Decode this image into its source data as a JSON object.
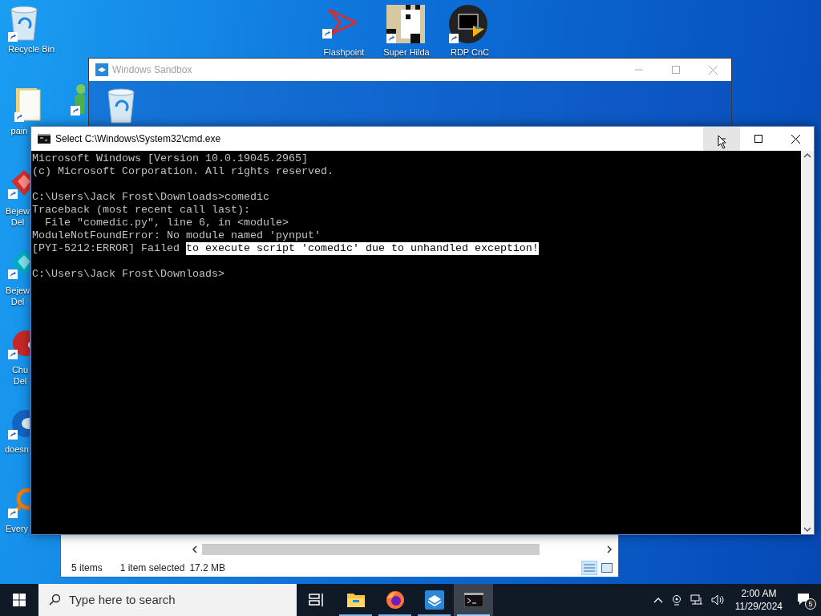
{
  "desktop_icons": [
    {
      "kind": "recycle-bin",
      "label": "Recycle Bin"
    },
    {
      "kind": "folder",
      "label": "pain"
    },
    {
      "kind": "person"
    },
    {
      "kind": "red-gem",
      "label": "Bejew Del"
    },
    {
      "kind": "blue-gem",
      "label": "Bejew Del"
    },
    {
      "kind": "red-ball",
      "label": "Chu Del"
    },
    {
      "kind": "blue-ball",
      "label": "doesn"
    },
    {
      "kind": "orange-ring",
      "label": "Every"
    },
    {
      "kind": "flashpoint",
      "label": "Flashpoint"
    },
    {
      "kind": "pixel-art",
      "label": "Super Hilda"
    },
    {
      "kind": "remote",
      "label": "RDP CnC"
    }
  ],
  "sandbox_window": {
    "title": "Windows Sandbox",
    "desktop_icons": [
      {
        "kind": "recycle-bin"
      }
    ]
  },
  "explorer_window": {
    "status": [
      {
        "text": "5 items"
      },
      {
        "text": "1 item selected"
      },
      {
        "text": "17.2 MB"
      }
    ],
    "views": [
      {
        "kind": "details",
        "selected": true
      },
      {
        "kind": "tiles",
        "selected": false
      }
    ]
  },
  "cmd_window": {
    "title": "Select C:\\Windows\\System32\\cmd.exe",
    "controls": [
      {
        "kind": "minimize",
        "hovered": true
      },
      {
        "kind": "maximize",
        "hovered": false
      },
      {
        "kind": "close",
        "hovered": false
      }
    ],
    "lines": [
      {
        "segments": [
          {
            "text": "Microsoft Windows [Version 10.0.19045.2965]",
            "selected": false
          }
        ]
      },
      {
        "segments": [
          {
            "text": "(c) Microsoft Corporation. All rights reserved.",
            "selected": false
          }
        ]
      },
      {
        "kind": "blank"
      },
      {
        "segments": [
          {
            "text": "C:\\Users\\Jack Frost\\Downloads>comedic",
            "selected": false
          }
        ]
      },
      {
        "segments": [
          {
            "text": "Traceback (most recent call last):",
            "selected": false
          }
        ]
      },
      {
        "segments": [
          {
            "text": "  File \"comedic.py\", line 6, in <module>",
            "selected": false
          }
        ]
      },
      {
        "segments": [
          {
            "text": "ModuleNotFoundError: No module named 'pynput'",
            "selected": false
          }
        ]
      },
      {
        "segments": [
          {
            "text": "[PYI-5212:ERROR] Failed ",
            "selected": false
          },
          {
            "text": "to execute script 'comedic' due to unhandled exception!",
            "selected": true
          }
        ]
      },
      {
        "kind": "blank"
      },
      {
        "segments": [
          {
            "text": "C:\\Users\\Jack Frost\\Downloads>",
            "selected": false
          }
        ]
      }
    ]
  },
  "taskbar": {
    "search_placeholder": "Type here to search",
    "apps": [
      {
        "kind": "task-view",
        "running": false,
        "selected": false
      },
      {
        "kind": "file-explorer",
        "running": true,
        "selected": false
      },
      {
        "kind": "firefox",
        "running": true,
        "selected": false
      },
      {
        "kind": "sandbox",
        "running": true,
        "selected": false
      },
      {
        "kind": "terminal",
        "running": true,
        "selected": true
      }
    ],
    "clock": {
      "time": "2:00 AM",
      "date": "11/29/2024"
    },
    "notification_count": "5"
  }
}
